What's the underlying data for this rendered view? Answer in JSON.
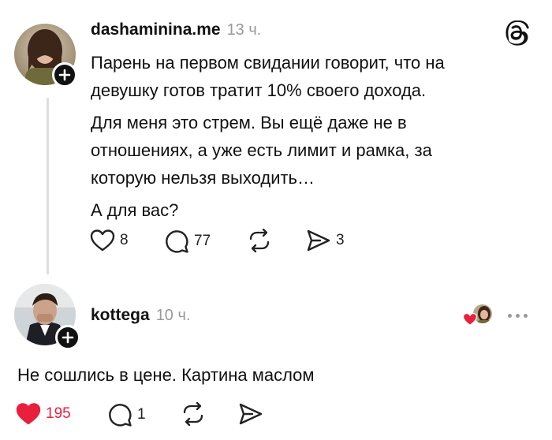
{
  "post": {
    "username": "dashaminina.me",
    "time": "13 ч.",
    "paragraphs": [
      "Парень на первом свидании говорит, что на девушку готов тратит 10% своего дохода.",
      "Для меня это стрем. Вы ещё даже не в отношениях, а уже есть лимит и рамка, за которую нельзя выходить…",
      "А для вас?"
    ],
    "likes": "8",
    "replies": "77",
    "reposts": "",
    "shares": "3",
    "app_icon": "threads-icon"
  },
  "reply": {
    "username": "kottega",
    "time": "10 ч.",
    "text": "Не сошлись в цене. Картина маслом",
    "likes": "195",
    "replies": "1",
    "liked_by_author": true,
    "like_color": "#e8203c"
  },
  "colors": {
    "text": "#111111",
    "muted": "#999999",
    "like_active": "#e8203c"
  }
}
